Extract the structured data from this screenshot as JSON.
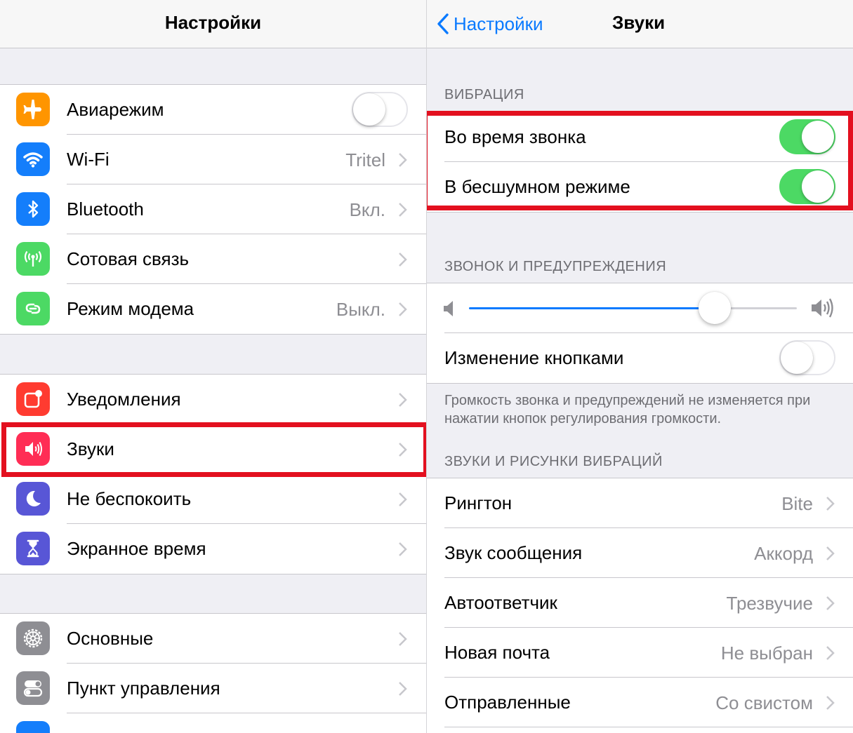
{
  "left": {
    "title": "Настройки",
    "groups": [
      {
        "rows": [
          {
            "label": "Авиарежим",
            "icon": "airplane-icon",
            "color": "#ff9500",
            "toggle": "off"
          },
          {
            "label": "Wi-Fi",
            "value": "Tritel",
            "icon": "wifi-icon",
            "color": "#147efb"
          },
          {
            "label": "Bluetooth",
            "value": "Вкл.",
            "icon": "bluetooth-icon",
            "color": "#147efb"
          },
          {
            "label": "Сотовая связь",
            "icon": "cellular-icon",
            "color": "#4cd964"
          },
          {
            "label": "Режим модема",
            "value": "Выкл.",
            "icon": "hotspot-icon",
            "color": "#4cd964"
          }
        ]
      },
      {
        "rows": [
          {
            "label": "Уведомления",
            "icon": "notifications-icon",
            "color": "#ff3b30"
          },
          {
            "label": "Звуки",
            "icon": "sounds-icon",
            "color": "#ff2d55",
            "highlighted": true
          },
          {
            "label": "Не беспокоить",
            "icon": "moon-icon",
            "color": "#5856d6"
          },
          {
            "label": "Экранное время",
            "icon": "hourglass-icon",
            "color": "#5856d6"
          }
        ]
      },
      {
        "rows": [
          {
            "label": "Основные",
            "icon": "gear-icon",
            "color": "#8e8e93"
          },
          {
            "label": "Пункт управления",
            "icon": "control-center-icon",
            "color": "#8e8e93"
          },
          {
            "label": "",
            "icon": "display-icon",
            "color": "#147efb"
          }
        ]
      }
    ]
  },
  "right": {
    "back_label": "Настройки",
    "title": "Звуки",
    "vibration": {
      "header": "ВИБРАЦИЯ",
      "rows": [
        {
          "label": "Во время звонка",
          "toggle": "on"
        },
        {
          "label": "В бесшумном режиме",
          "toggle": "on"
        }
      ]
    },
    "ringer": {
      "header": "ЗВОНОК И ПРЕДУПРЕЖДЕНИЯ",
      "volume_level": 0.75,
      "change_with_buttons": {
        "label": "Изменение кнопками",
        "toggle": "off"
      },
      "footer": "Громкость звонка и предупреждений не изменяется при нажатии кнопок регулирования громкости."
    },
    "patterns": {
      "header": "ЗВУКИ И РИСУНКИ ВИБРАЦИЙ",
      "rows": [
        {
          "label": "Рингтон",
          "value": "Bite"
        },
        {
          "label": "Звук сообщения",
          "value": "Аккорд"
        },
        {
          "label": "Автоответчик",
          "value": "Трезвучие"
        },
        {
          "label": "Новая почта",
          "value": "Не выбран"
        },
        {
          "label": "Отправленные",
          "value": "Со свистом"
        }
      ]
    }
  },
  "colors": {
    "accent": "#0a7aff",
    "toggle_on": "#4cd964",
    "highlight": "#e3101f",
    "slider_fill": "#0a7aff"
  }
}
